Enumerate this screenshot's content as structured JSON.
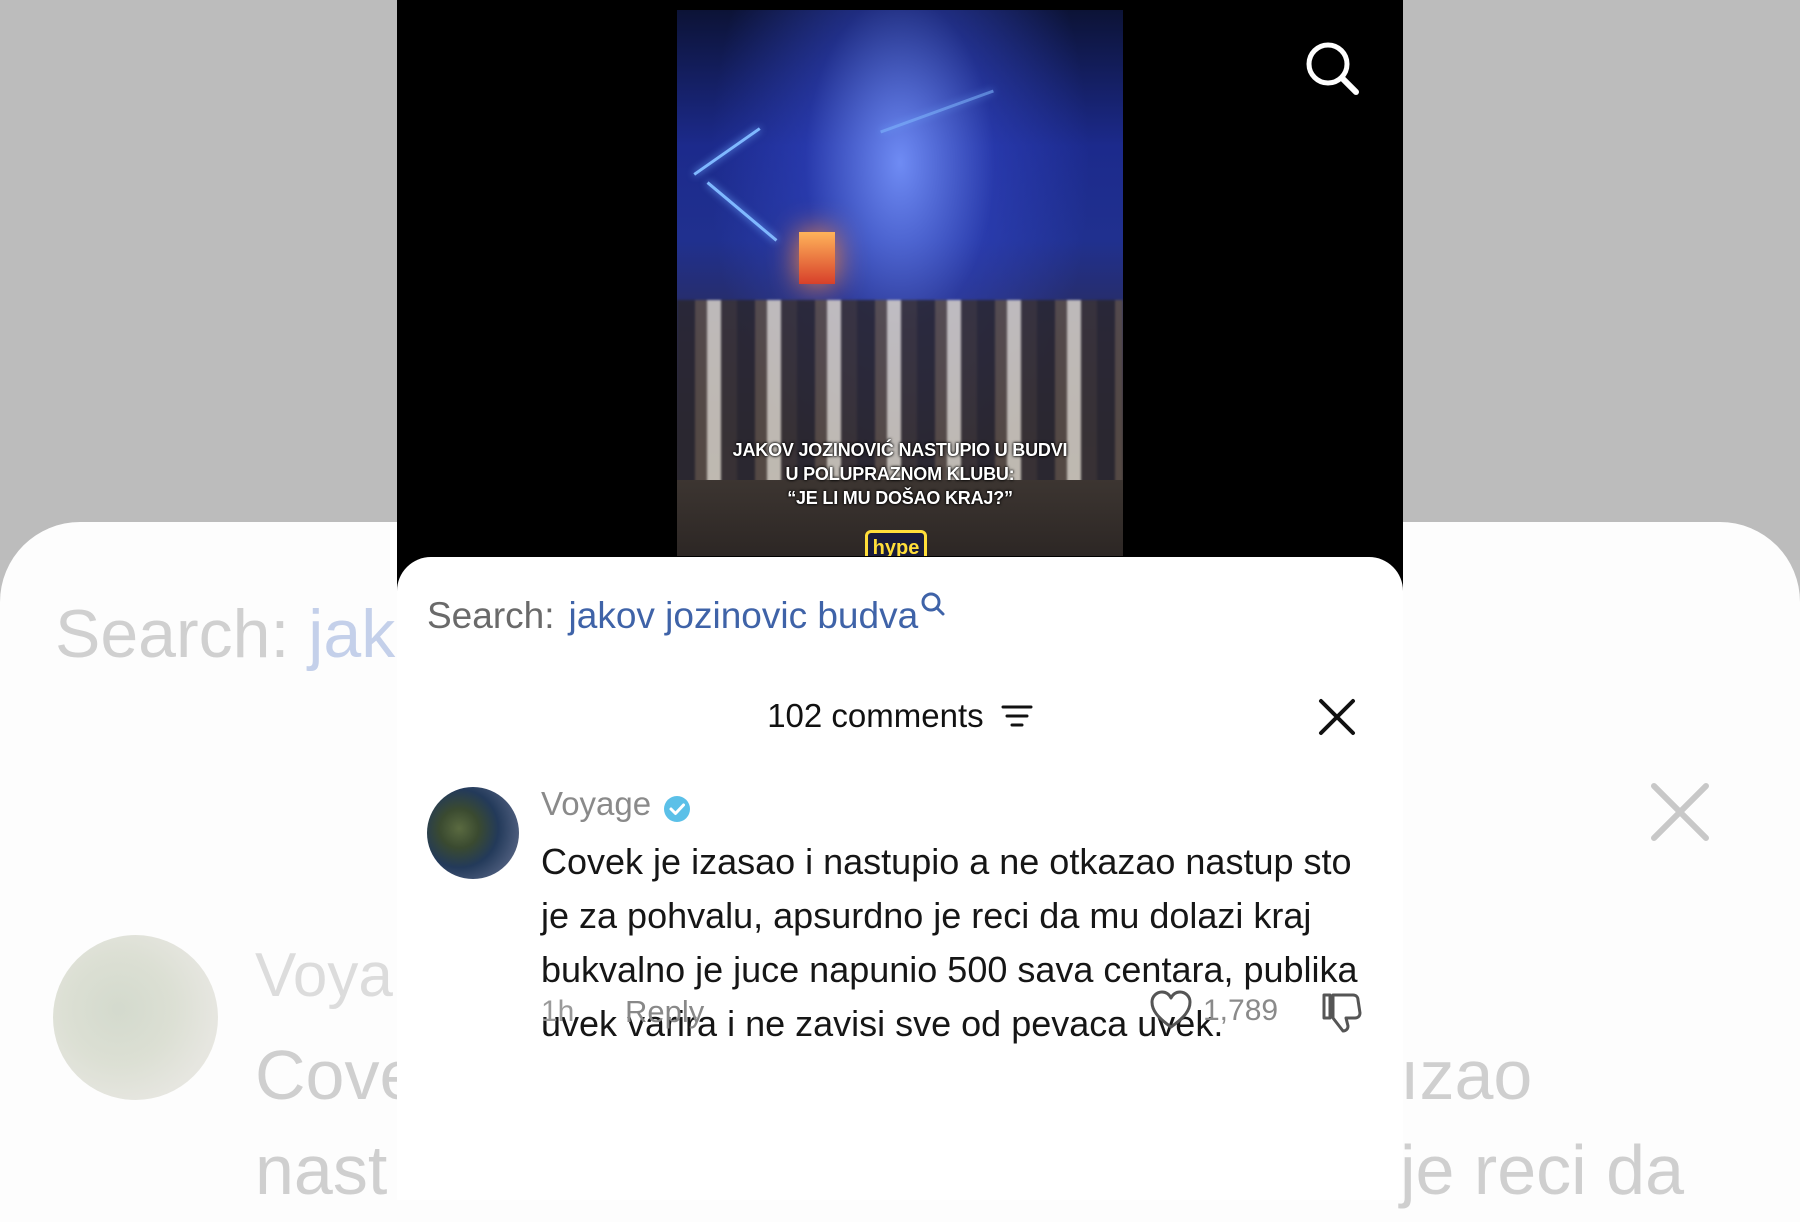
{
  "background": {
    "search_label": "Search:",
    "search_query_fragment": "jak",
    "name_fragment": "Voya",
    "line1_left": "Cove",
    "line2_left": "nast",
    "line1_right": "ızao",
    "line2_right": "je reci da"
  },
  "video": {
    "caption_line1": "JAKOV JOZINOVIĆ NASTUPIO U BUDVI",
    "caption_line2": "U POLUPRAZNOM KLUBU:",
    "caption_line3": "“JE LI MU DOŠAO KRAJ?”",
    "logo_text": "hype"
  },
  "sheet": {
    "search_label": "Search:",
    "search_query": "jakov jozinovic budva",
    "comments_count": "102 comments"
  },
  "comment": {
    "username": "Voyage",
    "text": "Covek je izasao i nastupio a ne otkazao nastup sto je za pohvalu, apsurdno je reci da mu dolazi kraj bukvalno je juce napunio 500 sava centara, publika uvek varira i ne zavisi sve od pevaca uvek.",
    "time": "1h",
    "reply_label": "Reply",
    "likes": "1,789"
  },
  "colors": {
    "accent": "#3f63a8",
    "verified": "#5bc0e8"
  }
}
